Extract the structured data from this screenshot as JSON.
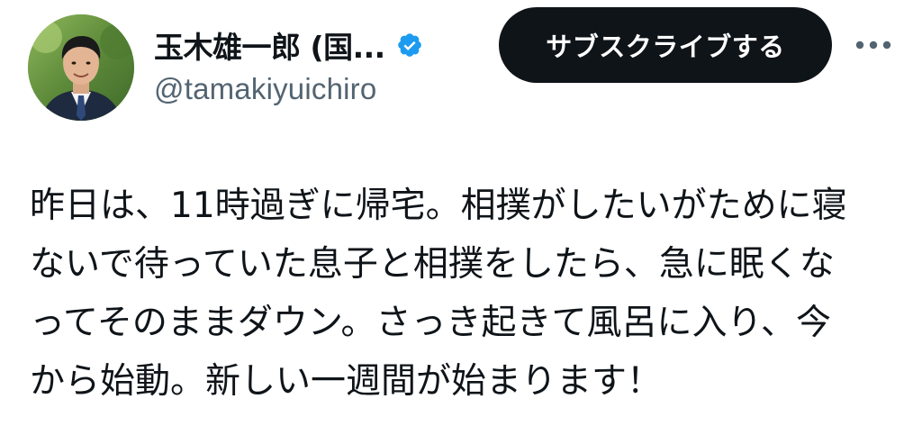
{
  "tweet": {
    "author": {
      "display_name": "玉木雄一郎 (国...",
      "handle": "@tamakiyuichiro",
      "verified": true,
      "avatar_icon": "profile-photo"
    },
    "subscribe_label": "サブスクライブする",
    "more_icon": "more-horizontal-icon",
    "text_lines": [
      "昨日は、11時過ぎに帰宅。相撲がしたいがために寝",
      "ないで待っていた息子と相撲をしたら、急に眠くな",
      "ってそのままダウン。さっき起きて風呂に入り、今",
      "から始動。新しい一週間が始まります！"
    ]
  },
  "colors": {
    "text_primary": "#0f1419",
    "text_secondary": "#536471",
    "verified_blue": "#1d9bf0",
    "button_bg": "#0f1419",
    "button_text": "#ffffff",
    "background": "#ffffff"
  }
}
